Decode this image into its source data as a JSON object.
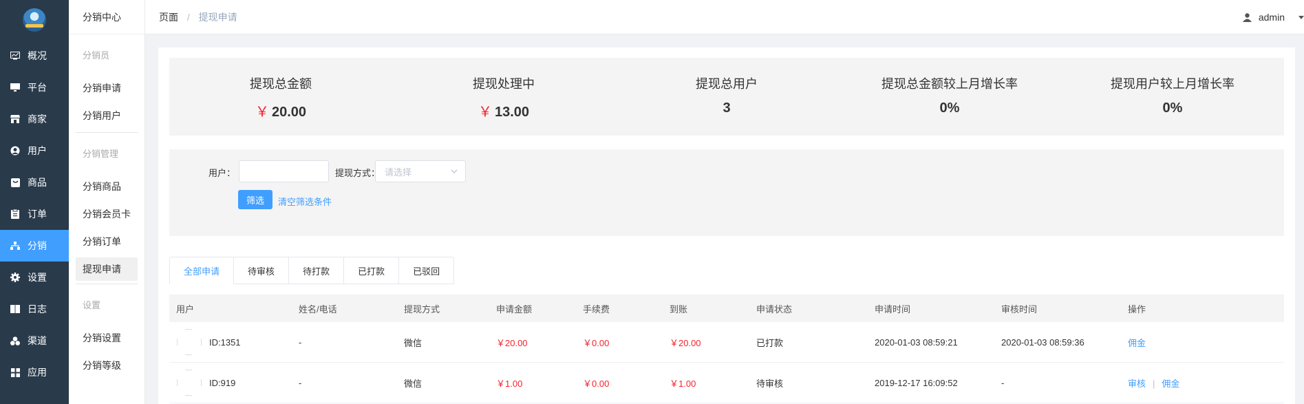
{
  "sidebar": {
    "items": [
      {
        "label": "概况",
        "icon": "chart-icon"
      },
      {
        "label": "平台",
        "icon": "monitor-icon"
      },
      {
        "label": "商家",
        "icon": "shop-icon"
      },
      {
        "label": "用户",
        "icon": "user-icon"
      },
      {
        "label": "商品",
        "icon": "goods-icon"
      },
      {
        "label": "订单",
        "icon": "order-icon"
      },
      {
        "label": "分销",
        "icon": "distribution-icon",
        "active": true
      },
      {
        "label": "设置",
        "icon": "gear-icon"
      },
      {
        "label": "日志",
        "icon": "log-icon"
      },
      {
        "label": "渠道",
        "icon": "channel-icon"
      },
      {
        "label": "应用",
        "icon": "apps-icon"
      }
    ]
  },
  "submenu": {
    "title": "分销中心",
    "group1": "分销员",
    "g1_items": [
      "分销申请",
      "分销用户"
    ],
    "group2": "分销管理",
    "g2_items": [
      "分销商品",
      "分销会员卡",
      "分销订单",
      "提现申请"
    ],
    "group3": "设置",
    "g3_items": [
      "分销设置",
      "分销等级"
    ]
  },
  "header": {
    "crumb_root": "页面",
    "crumb_sep": "/",
    "crumb_current": "提现申请",
    "user": "admin"
  },
  "stats": [
    {
      "label": "提现总金额",
      "currency": "￥",
      "value": "20.00"
    },
    {
      "label": "提现处理中",
      "currency": "￥",
      "value": "13.00"
    },
    {
      "label": "提现总用户",
      "currency": "",
      "value": "3"
    },
    {
      "label": "提现总金额较上月增长率",
      "currency": "",
      "value": "0%"
    },
    {
      "label": "提现用户较上月增长率",
      "currency": "",
      "value": "0%"
    }
  ],
  "filter": {
    "user_label": "用户：",
    "user_value": "",
    "method_label": "提现方式：",
    "method_placeholder": "请选择",
    "search_button": "筛选",
    "clear_link": "清空筛选条件"
  },
  "tabs": [
    "全部申请",
    "待审核",
    "待打款",
    "已打款",
    "已驳回"
  ],
  "table": {
    "headers": [
      "用户",
      "姓名/电话",
      "提现方式",
      "申请金额",
      "手续费",
      "到账",
      "申请状态",
      "申请时间",
      "审核时间",
      "操作"
    ],
    "rows": [
      {
        "user": "ID:1351",
        "name_phone": "-",
        "method": "微信",
        "amount": "￥20.00",
        "fee": "￥0.00",
        "received": "￥20.00",
        "status": "已打款",
        "apply_time": "2020-01-03 08:59:21",
        "review_time": "2020-01-03 08:59:36",
        "op1": "佣金",
        "op2": ""
      },
      {
        "user": "ID:919",
        "name_phone": "-",
        "method": "微信",
        "amount": "￥1.00",
        "fee": "￥0.00",
        "received": "￥1.00",
        "status": "待审核",
        "apply_time": "2019-12-17 16:09:52",
        "review_time": "-",
        "op1": "审核",
        "op2": "佣金"
      }
    ],
    "op_sep": "|"
  }
}
